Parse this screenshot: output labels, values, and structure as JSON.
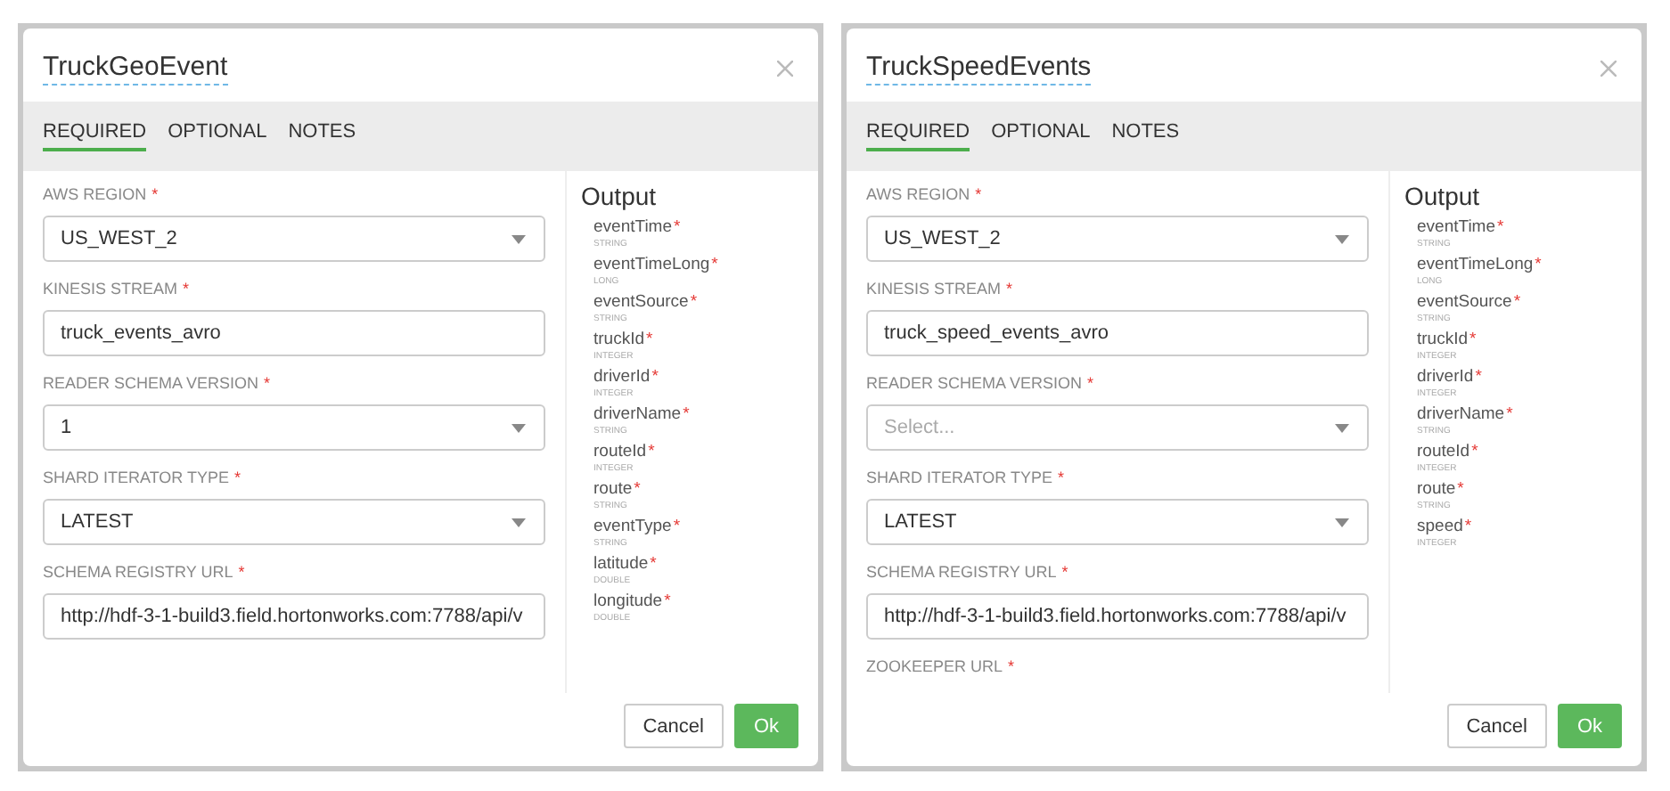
{
  "dialogs": [
    {
      "title": "TruckGeoEvent",
      "tabs": [
        {
          "label": "REQUIRED",
          "selected": true
        },
        {
          "label": "OPTIONAL",
          "selected": false
        },
        {
          "label": "NOTES",
          "selected": false
        }
      ],
      "fields": [
        {
          "label": "AWS REGION",
          "required_mark": "*",
          "kind": "select",
          "value": "US_WEST_2"
        },
        {
          "label": "KINESIS STREAM",
          "required_mark": "*",
          "kind": "text",
          "value": "truck_events_avro"
        },
        {
          "label": "READER SCHEMA VERSION",
          "required_mark": "*",
          "kind": "select",
          "value": "1"
        },
        {
          "label": "SHARD ITERATOR TYPE",
          "required_mark": "*",
          "kind": "select",
          "value": "LATEST"
        },
        {
          "label": "SCHEMA REGISTRY URL",
          "required_mark": "*",
          "kind": "text",
          "value": "http://hdf-3-1-build3.field.hortonworks.com:7788/api/v"
        }
      ],
      "output_title": "Output",
      "outputs": [
        {
          "name": "eventTime",
          "type": "STRING",
          "required_mark": "*"
        },
        {
          "name": "eventTimeLong",
          "type": "LONG",
          "required_mark": "*"
        },
        {
          "name": "eventSource",
          "type": "STRING",
          "required_mark": "*"
        },
        {
          "name": "truckId",
          "type": "INTEGER",
          "required_mark": "*"
        },
        {
          "name": "driverId",
          "type": "INTEGER",
          "required_mark": "*"
        },
        {
          "name": "driverName",
          "type": "STRING",
          "required_mark": "*"
        },
        {
          "name": "routeId",
          "type": "INTEGER",
          "required_mark": "*"
        },
        {
          "name": "route",
          "type": "STRING",
          "required_mark": "*"
        },
        {
          "name": "eventType",
          "type": "STRING",
          "required_mark": "*"
        },
        {
          "name": "latitude",
          "type": "DOUBLE",
          "required_mark": "*"
        },
        {
          "name": "longitude",
          "type": "DOUBLE",
          "required_mark": "*"
        }
      ],
      "buttons": [
        {
          "label": "Cancel",
          "kind": "secondary"
        },
        {
          "label": "Ok",
          "kind": "primary"
        }
      ]
    },
    {
      "title": "TruckSpeedEvents",
      "tabs": [
        {
          "label": "REQUIRED",
          "selected": true
        },
        {
          "label": "OPTIONAL",
          "selected": false
        },
        {
          "label": "NOTES",
          "selected": false
        }
      ],
      "fields": [
        {
          "label": "AWS REGION",
          "required_mark": "*",
          "kind": "select",
          "value": "US_WEST_2"
        },
        {
          "label": "KINESIS STREAM",
          "required_mark": "*",
          "kind": "text",
          "value": "truck_speed_events_avro"
        },
        {
          "label": "READER SCHEMA VERSION",
          "required_mark": "*",
          "kind": "select",
          "placeholder": "Select..."
        },
        {
          "label": "SHARD ITERATOR TYPE",
          "required_mark": "*",
          "kind": "select",
          "value": "LATEST"
        },
        {
          "label": "SCHEMA REGISTRY URL",
          "required_mark": "*",
          "kind": "text",
          "value": "http://hdf-3-1-build3.field.hortonworks.com:7788/api/v"
        },
        {
          "label": "ZOOKEEPER URL",
          "required_mark": "*",
          "kind": "label"
        }
      ],
      "output_title": "Output",
      "outputs": [
        {
          "name": "eventTime",
          "type": "STRING",
          "required_mark": "*"
        },
        {
          "name": "eventTimeLong",
          "type": "LONG",
          "required_mark": "*"
        },
        {
          "name": "eventSource",
          "type": "STRING",
          "required_mark": "*"
        },
        {
          "name": "truckId",
          "type": "INTEGER",
          "required_mark": "*"
        },
        {
          "name": "driverId",
          "type": "INTEGER",
          "required_mark": "*"
        },
        {
          "name": "driverName",
          "type": "STRING",
          "required_mark": "*"
        },
        {
          "name": "routeId",
          "type": "INTEGER",
          "required_mark": "*"
        },
        {
          "name": "route",
          "type": "STRING",
          "required_mark": "*"
        },
        {
          "name": "speed",
          "type": "INTEGER",
          "required_mark": "*"
        }
      ],
      "buttons": [
        {
          "label": "Cancel",
          "kind": "secondary"
        },
        {
          "label": "Ok",
          "kind": "primary"
        }
      ]
    }
  ]
}
